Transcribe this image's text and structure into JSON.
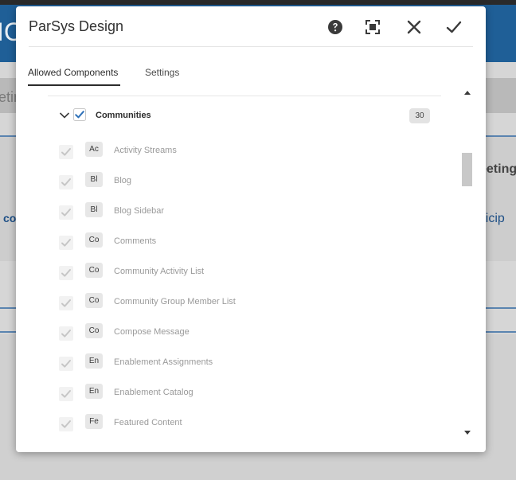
{
  "background": {
    "header_fragment": "IC",
    "band_fragment": "eting",
    "left_fragment": "co",
    "right_fragment_1": "eeting",
    "right_fragment_2": "rticip"
  },
  "dialog": {
    "title": "ParSys Design",
    "header_buttons": [
      {
        "name": "help-button",
        "icon": "help-icon"
      },
      {
        "name": "fullscreen-button",
        "icon": "fullscreen-icon"
      },
      {
        "name": "close-button",
        "icon": "close-icon"
      },
      {
        "name": "confirm-button",
        "icon": "check-icon"
      }
    ],
    "tabs": [
      {
        "label": "Allowed Components",
        "active": true
      },
      {
        "label": "Settings",
        "active": false
      }
    ]
  },
  "group": {
    "label": "Communities",
    "count": "30",
    "checked": true,
    "expanded": true
  },
  "items": [
    {
      "badge": "Ac",
      "label": "Activity Streams"
    },
    {
      "badge": "Bl",
      "label": "Blog"
    },
    {
      "badge": "Bl",
      "label": "Blog Sidebar"
    },
    {
      "badge": "Co",
      "label": "Comments"
    },
    {
      "badge": "Co",
      "label": "Community Activity List"
    },
    {
      "badge": "Co",
      "label": "Community Group Member List"
    },
    {
      "badge": "Co",
      "label": "Compose Message"
    },
    {
      "badge": "En",
      "label": "Enablement Assignments"
    },
    {
      "badge": "En",
      "label": "Enablement Catalog"
    },
    {
      "badge": "Fe",
      "label": "Featured Content"
    }
  ],
  "colors": {
    "accent": "#2c6fb7",
    "header_bg": "#1f5f97",
    "disabled_check": "#c6c6c6"
  }
}
